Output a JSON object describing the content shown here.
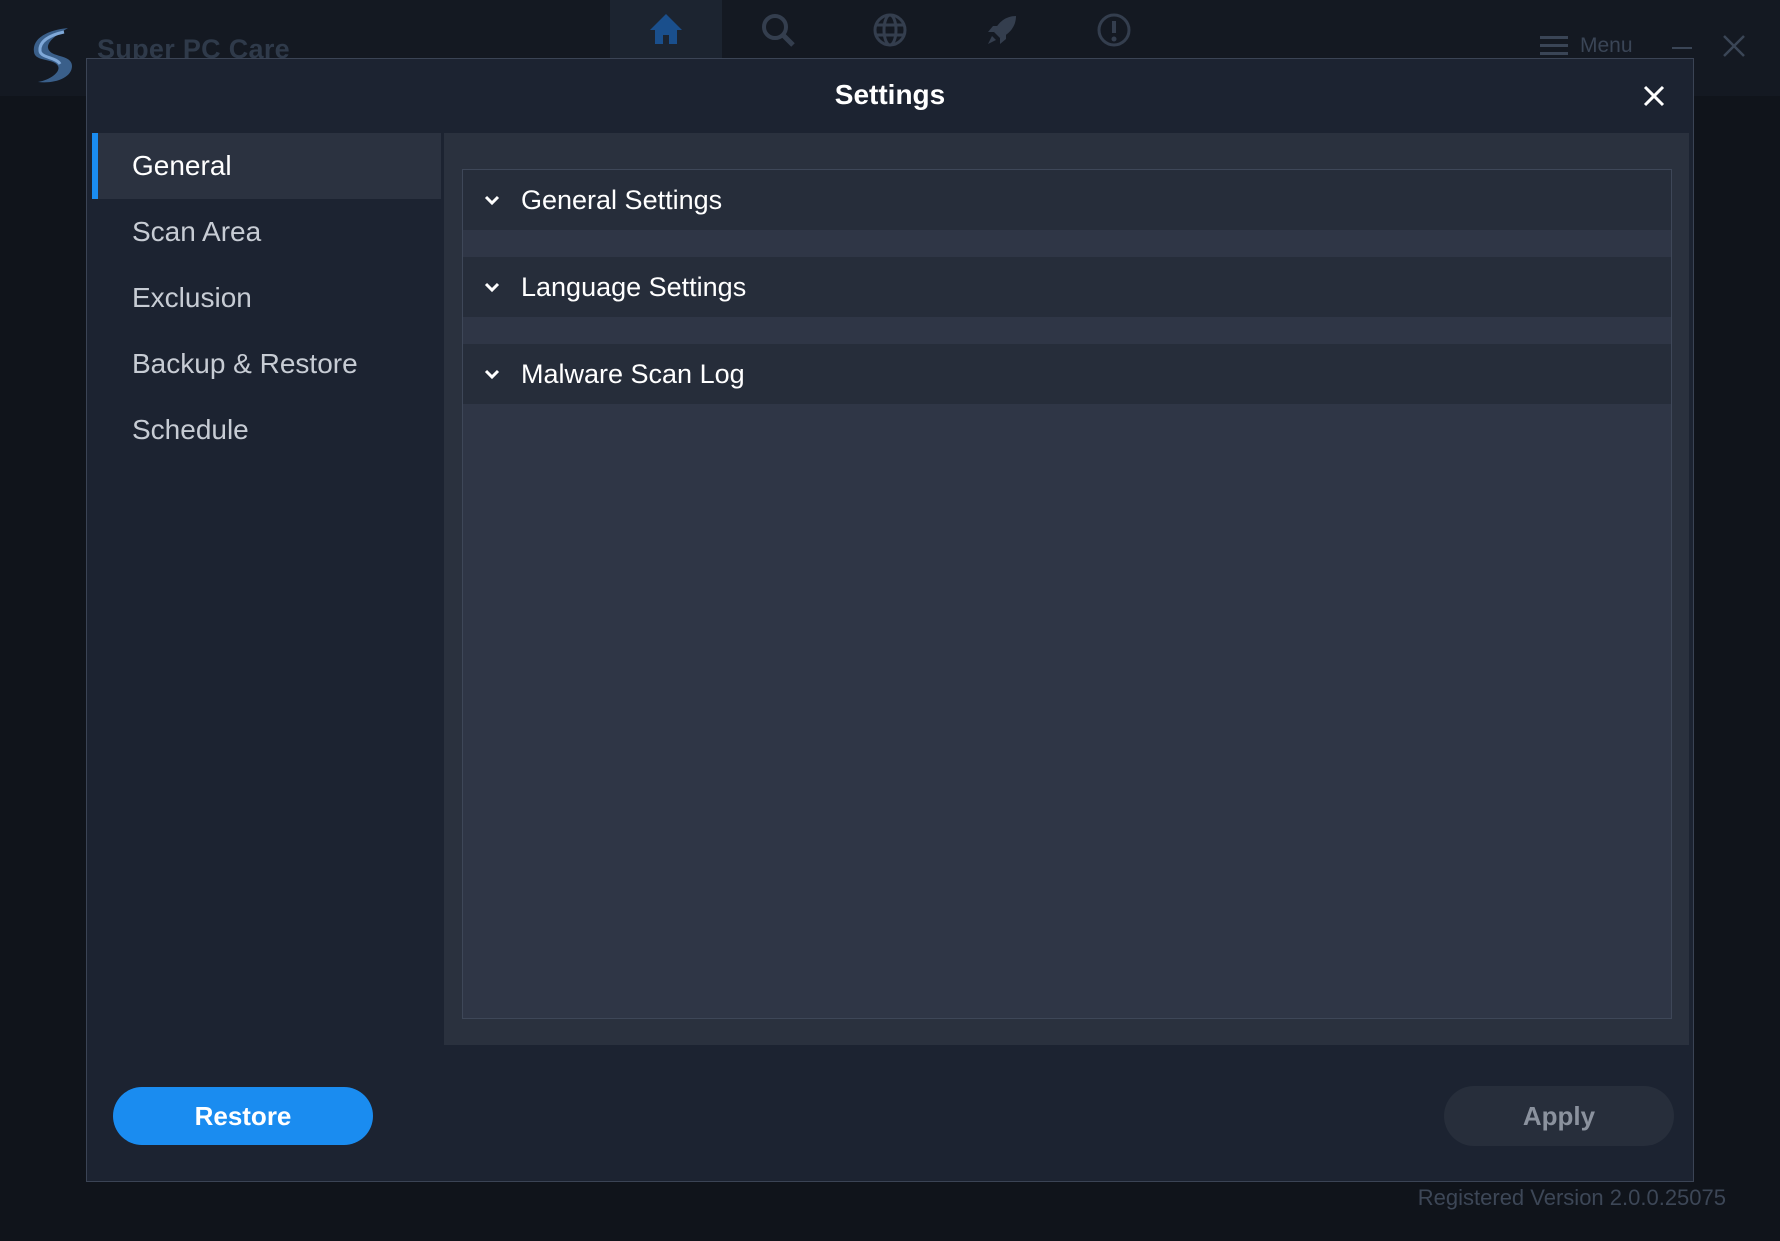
{
  "app": {
    "title": "Super PC Care",
    "nav": [
      {
        "icon": "home-icon",
        "active": true
      },
      {
        "icon": "search-icon",
        "active": false
      },
      {
        "icon": "globe-icon",
        "active": false
      },
      {
        "icon": "rocket-icon",
        "active": false
      },
      {
        "icon": "info-icon",
        "active": false
      }
    ],
    "menu_label": "Menu",
    "version": "Registered Version 2.0.0.25075"
  },
  "dialog": {
    "title": "Settings",
    "sidebar": {
      "items": [
        {
          "label": "General",
          "active": true
        },
        {
          "label": "Scan Area",
          "active": false
        },
        {
          "label": "Exclusion",
          "active": false
        },
        {
          "label": "Backup & Restore",
          "active": false
        },
        {
          "label": "Schedule",
          "active": false
        }
      ]
    },
    "sections": [
      {
        "label": "General Settings"
      },
      {
        "label": "Language Settings"
      },
      {
        "label": "Malware Scan Log"
      }
    ],
    "buttons": {
      "restore": "Restore",
      "apply": "Apply"
    }
  },
  "colors": {
    "accent": "#1a8cf0",
    "background": "#10141b",
    "dialog": "#1c2331",
    "panel": "#2f3646"
  }
}
